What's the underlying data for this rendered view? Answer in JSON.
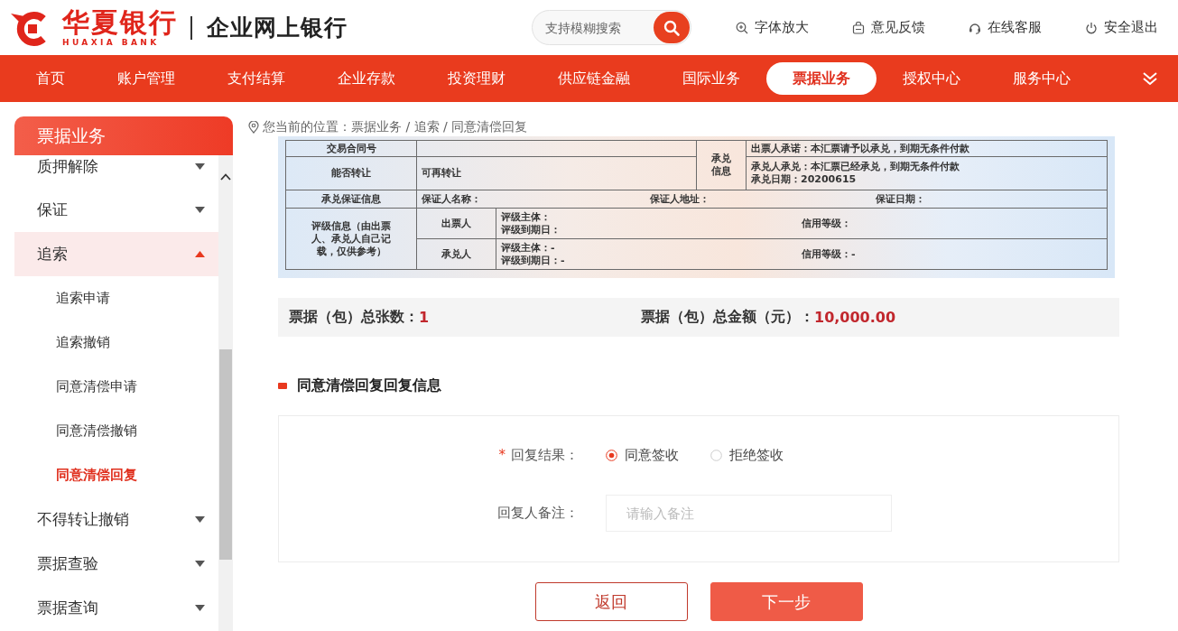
{
  "header": {
    "logo": {
      "name": "华夏银行",
      "subtitle": "HUAXIA BANK"
    },
    "portal_title": "企业网上银行",
    "search": {
      "placeholder": "支持模糊搜索"
    },
    "links": [
      {
        "label": "字体放大",
        "kind": "font_size"
      },
      {
        "label": "意见反馈",
        "kind": "feedback"
      },
      {
        "label": "在线客服",
        "kind": "support"
      },
      {
        "label": "安全退出",
        "kind": "logout"
      }
    ]
  },
  "nav": {
    "items": [
      {
        "label": "首页",
        "selected": false
      },
      {
        "label": "账户管理",
        "selected": false
      },
      {
        "label": "支付结算",
        "selected": false
      },
      {
        "label": "企业存款",
        "selected": false
      },
      {
        "label": "投资理财",
        "selected": false
      },
      {
        "label": "供应链金融",
        "selected": false
      },
      {
        "label": "国际业务",
        "selected": false
      },
      {
        "label": "票据业务",
        "selected": true
      },
      {
        "label": "授权中心",
        "selected": false
      },
      {
        "label": "服务中心",
        "selected": false
      }
    ]
  },
  "sidebar": {
    "title": "票据业务",
    "items": [
      {
        "label": "质押解除",
        "expanded": false
      },
      {
        "label": "保证",
        "expanded": false
      },
      {
        "label": "追索",
        "expanded": true,
        "children": [
          {
            "label": "追索申请",
            "selected": false
          },
          {
            "label": "追索撤销",
            "selected": false
          },
          {
            "label": "同意清偿申请",
            "selected": false
          },
          {
            "label": "同意清偿撤销",
            "selected": false
          },
          {
            "label": "同意清偿回复",
            "selected": true
          }
        ]
      },
      {
        "label": "不得转让撤销",
        "expanded": false
      },
      {
        "label": "票据查验",
        "expanded": false
      },
      {
        "label": "票据查询",
        "expanded": false
      }
    ]
  },
  "breadcrumb": "您当前的位置：票据业务 / 追索 / 同意清偿回复",
  "bill": {
    "contract_label": "交易合同号",
    "transfer_label": "能否转让",
    "transfer_value": "可再转让",
    "acceptance_label": "承兑信息",
    "drawer_promise": "出票人承诺：本汇票请予以承兑，到期无条件付款",
    "acceptor_promise": "承兑人承兑：本汇票已经承兑，到期无条件付款",
    "acceptance_date": "承兑日期：20200615",
    "guarantee_label": "承兑保证信息",
    "guarantee_fields": [
      "保证人名称：",
      "保证人地址：",
      "保证日期："
    ],
    "rating_label": "评级信息（由出票人、承兑人自己记载，仅供参考）",
    "ratings": [
      {
        "party": "出票人",
        "subject": "评级主体：",
        "expiry": "评级到期日：",
        "grade": "信用等级："
      },
      {
        "party": "承兑人",
        "subject": "评级主体：-",
        "expiry": "评级到期日：-",
        "grade": "信用等级：-"
      }
    ]
  },
  "summary": [
    {
      "label": "票据（包）总张数：",
      "value": "1"
    },
    {
      "label": "票据（包）总金额（元）：",
      "value": "10,000.00"
    }
  ],
  "section_title": "同意清偿回复回复信息",
  "form": {
    "result": {
      "required_mark": "*",
      "label": "回复结果：",
      "options": [
        {
          "label": "同意签收",
          "selected": true
        },
        {
          "label": "拒绝签收",
          "selected": false
        }
      ]
    },
    "remark": {
      "label": "回复人备注：",
      "placeholder": "请输入备注"
    }
  },
  "buttons": [
    {
      "label": "返回",
      "kind": "secondary"
    },
    {
      "label": "下一步",
      "kind": "primary"
    }
  ]
}
